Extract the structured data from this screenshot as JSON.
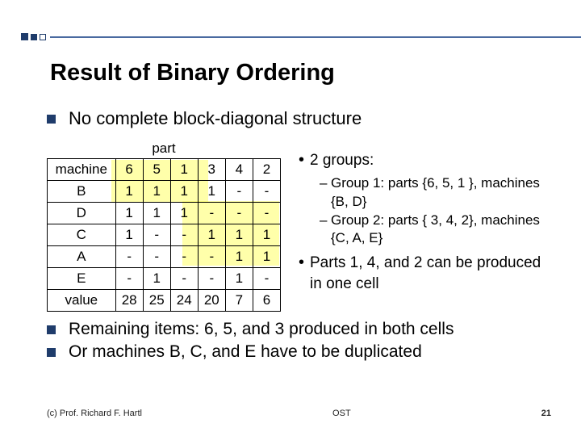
{
  "title": "Result of Binary Ordering",
  "top_bullet": "No complete block-diagonal structure",
  "part_label": "part",
  "table": {
    "col_header_label": "machine",
    "part_cols": [
      "6",
      "5",
      "1",
      "3",
      "4",
      "2"
    ],
    "rows": [
      {
        "m": "B",
        "c": [
          "1",
          "1",
          "1",
          "1",
          "-",
          "-"
        ]
      },
      {
        "m": "D",
        "c": [
          "1",
          "1",
          "1",
          "-",
          "-",
          "-"
        ]
      },
      {
        "m": "C",
        "c": [
          "1",
          "-",
          "-",
          "1",
          "1",
          "1"
        ]
      },
      {
        "m": "A",
        "c": [
          "-",
          "-",
          "-",
          "-",
          "1",
          "1"
        ]
      },
      {
        "m": "E",
        "c": [
          "-",
          "1",
          "-",
          "-",
          "1",
          "-"
        ]
      }
    ],
    "value_label": "value",
    "values": [
      "28",
      "25",
      "24",
      "20",
      "7",
      "6"
    ]
  },
  "right": {
    "item1": "2 groups:",
    "sub1": "Group 1: parts {6, 5, 1 }, machines {B, D}",
    "sub2": "Group 2: parts { 3, 4, 2}, machines {C, A, E}",
    "item2": "Parts 1, 4, and 2 can be produced in one cell"
  },
  "bottom": {
    "b1": "Remaining items: 6, 5, and 3 produced in both cells",
    "b2": "Or machines B, C, and E have to be duplicated"
  },
  "footer": {
    "left": "(c) Prof. Richard F. Hartl",
    "center": "OST",
    "page": "21"
  }
}
